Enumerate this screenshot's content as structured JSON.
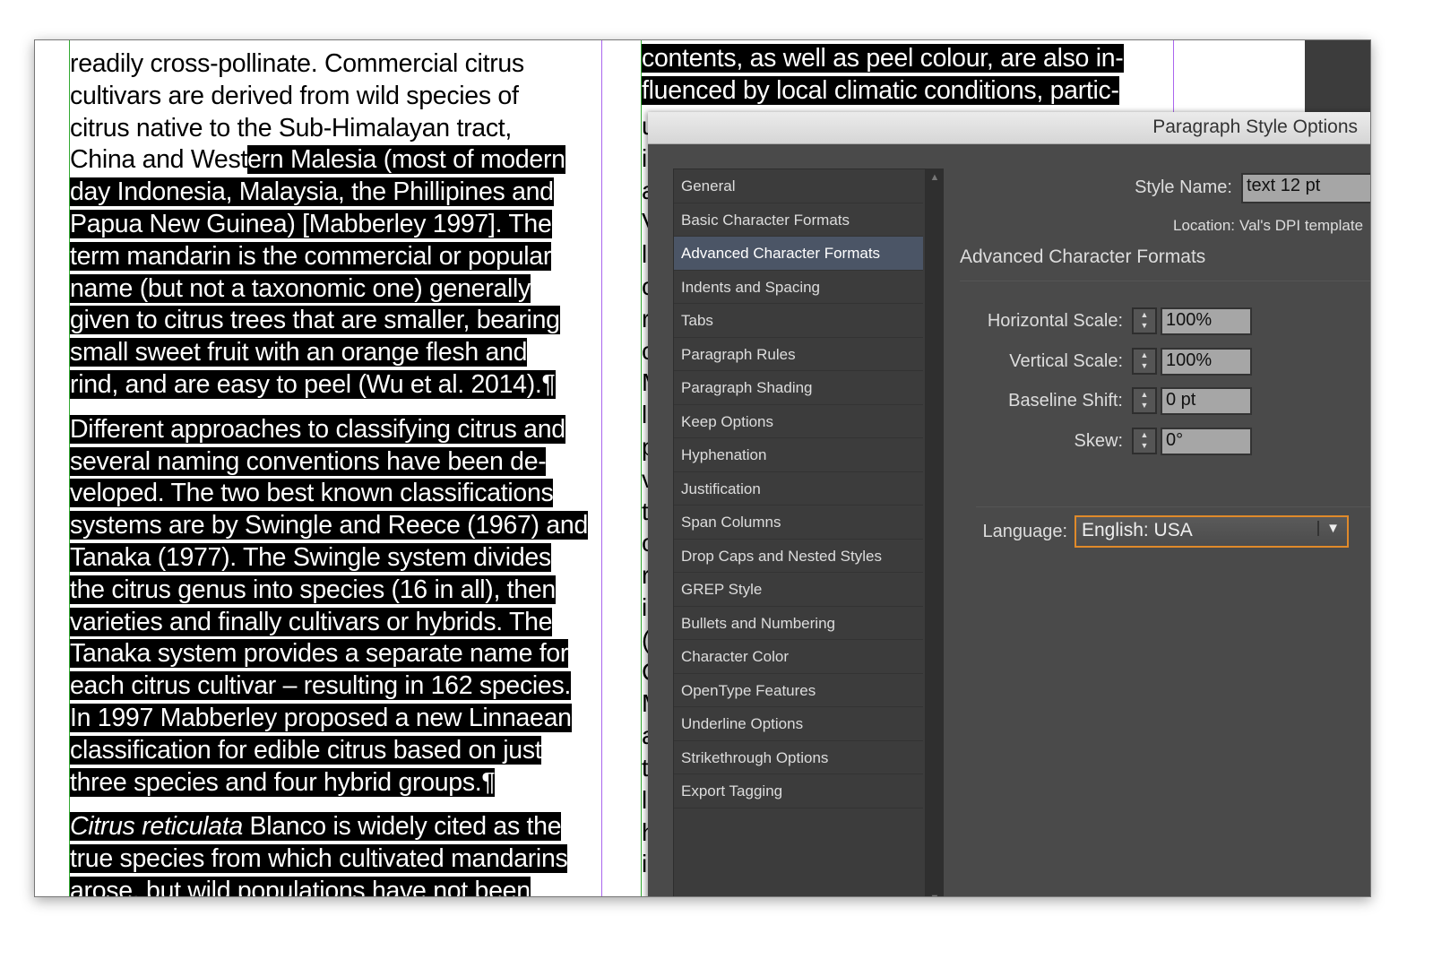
{
  "document": {
    "column1": [
      [
        [
          "readily cross-pollinate. Commercial citrus",
          ""
        ]
      ],
      [
        [
          "cultivars are derived from wild species of",
          ""
        ]
      ],
      [
        [
          "citrus native to the Sub-Himalayan tract,",
          ""
        ]
      ],
      [
        [
          "China and West",
          "ern Malesia (most of modern"
        ]
      ],
      [
        [
          "",
          "day Indonesia, Malaysia, the Phillipines and"
        ]
      ],
      [
        [
          "",
          "Papua New Guinea) [Mabberley 1997]. The"
        ]
      ],
      [
        [
          "",
          "term mandarin is the commercial or popular"
        ]
      ],
      [
        [
          "",
          "name (but not a taxonomic one) generally"
        ]
      ],
      [
        [
          "",
          "given to citrus trees that are smaller, bearing"
        ]
      ],
      [
        [
          "",
          "small sweet fruit with an orange flesh and"
        ]
      ],
      [
        [
          "",
          "rind, and are easy to peel (Wu et al. 2014).¶"
        ]
      ]
    ],
    "paragraph2": [
      "Different approaches to classifying citrus and",
      "several naming conventions have been de-",
      "veloped. The two best known classifications",
      "systems are by Swingle and Reece (1967) and",
      "Tanaka (1977). The Swingle system divides",
      "the citrus genus into species (16 in all), then",
      "varieties and finally cultivars or hybrids. The",
      "Tanaka system provides a separate name for",
      "each citrus cultivar – resulting in 162 species.",
      "In 1997 Mabberley proposed a new Linnaean",
      "classification for edible citrus based on just",
      "three species and four hybrid groups.¶"
    ],
    "paragraph3": {
      "italic": "Citrus reticulata",
      "lines": [
        " Blanco is widely cited as the",
        "true species from which cultivated mandarins",
        "arose, but wild populations have not been"
      ]
    },
    "column2": [
      "contents, as well as peel colour, are also in-",
      "fluenced by local climatic conditions, partic-"
    ],
    "column2_fragments": [
      "u",
      "i",
      "a",
      "V",
      "l",
      "c",
      "r",
      "c",
      "M",
      "l",
      "p",
      "v",
      "t",
      "c",
      "r",
      "i",
      "(",
      "C",
      "M",
      "a",
      "t",
      "l",
      "h",
      "i"
    ]
  },
  "dialog": {
    "title": "Paragraph Style Options",
    "categories": [
      "General",
      "Basic Character Formats",
      "Advanced Character Formats",
      "Indents and Spacing",
      "Tabs",
      "Paragraph Rules",
      "Paragraph Shading",
      "Keep Options",
      "Hyphenation",
      "Justification",
      "Span Columns",
      "Drop Caps and Nested Styles",
      "GREP Style",
      "Bullets and Numbering",
      "Character Color",
      "OpenType Features",
      "Underline Options",
      "Strikethrough Options",
      "Export Tagging"
    ],
    "selected_category": "Advanced Character Formats",
    "style_name_label": "Style Name:",
    "style_name": "text 12 pt",
    "location_label": "Location:",
    "location": "Val's DPI template",
    "section_title": "Advanced Character Formats",
    "fields": [
      {
        "label": "Horizontal Scale:",
        "value": "100%"
      },
      {
        "label": "Vertical Scale:",
        "value": "100%"
      },
      {
        "label": "Baseline Shift:",
        "value": "0 pt"
      },
      {
        "label": "Skew:",
        "value": "0°"
      }
    ],
    "language_label": "Language:",
    "language": "English: USA",
    "accent": "#e08a2a"
  }
}
